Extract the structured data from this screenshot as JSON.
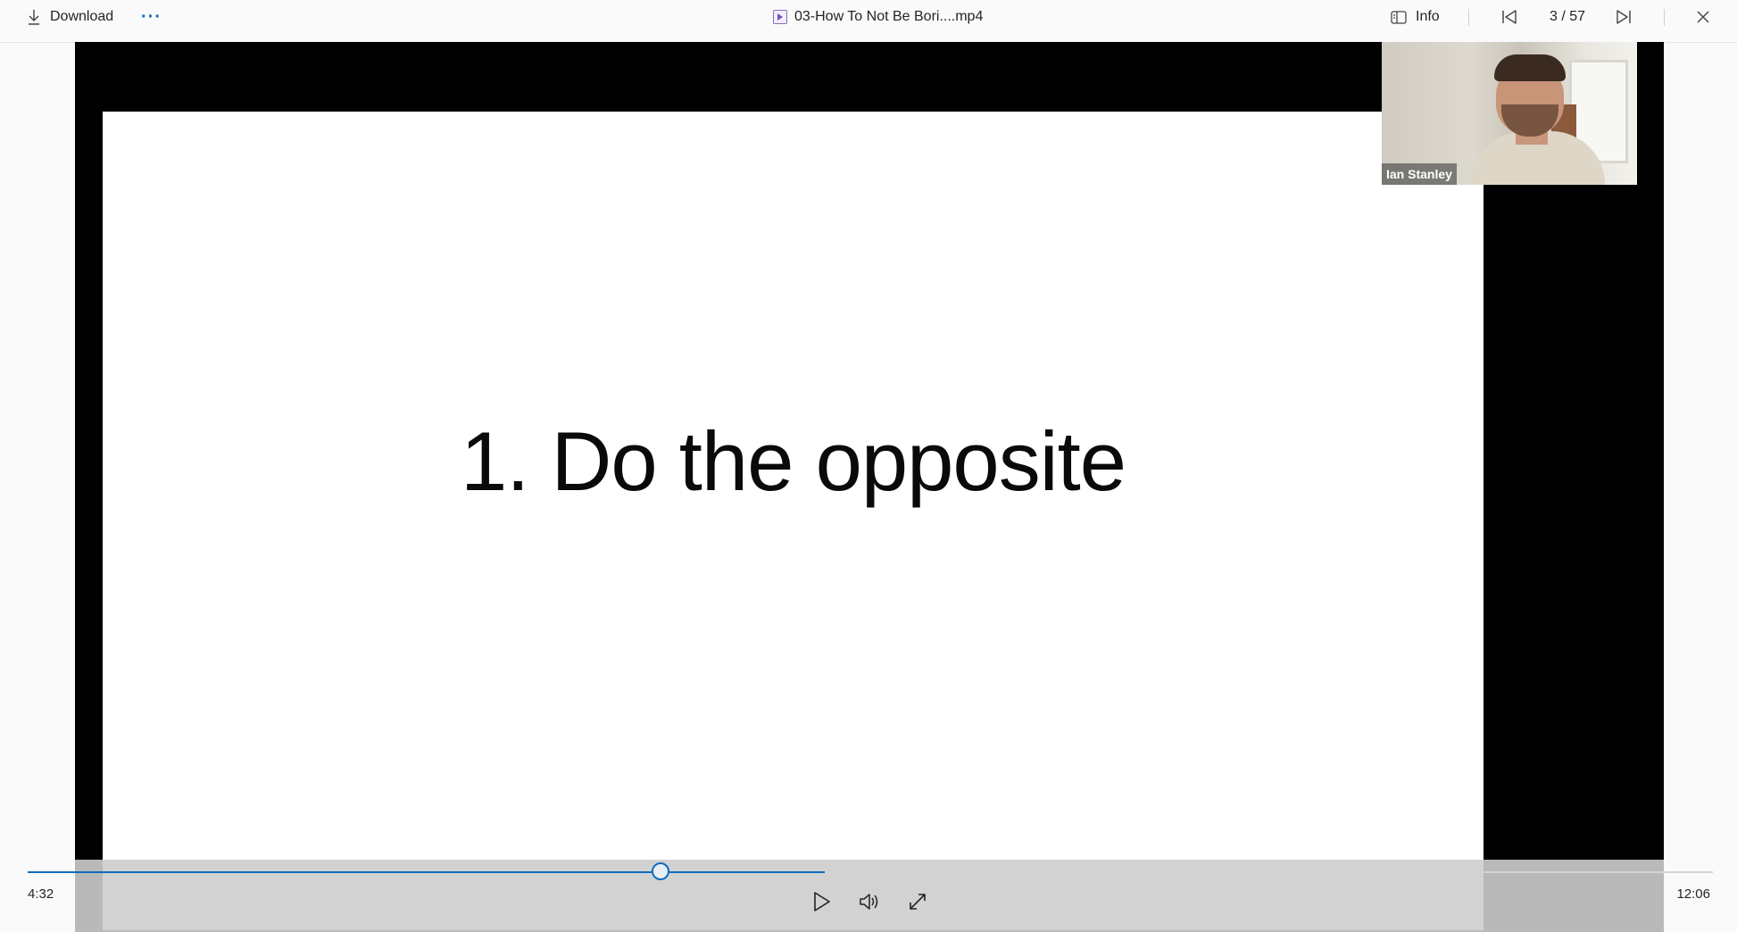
{
  "toolbar": {
    "download_label": "Download",
    "more_label": "···",
    "file_name": "03-How To Not Be Bori....mp4",
    "info_label": "Info",
    "counter": "3 / 57"
  },
  "video": {
    "slide_text": "1. Do the opposite",
    "presenter_name": "Ian Stanley"
  },
  "player": {
    "current_time": "4:32",
    "total_time": "12:06",
    "progress": 0.376,
    "buffered": 0.4732
  },
  "colors": {
    "accent": "#0f6cbd",
    "background": "#fafafa",
    "stage": "#000000"
  },
  "icons": [
    "download-icon",
    "more-icon",
    "video-file-icon",
    "info-icon",
    "previous-icon",
    "next-icon",
    "close-icon",
    "play-icon",
    "volume-icon",
    "fullscreen-icon"
  ]
}
